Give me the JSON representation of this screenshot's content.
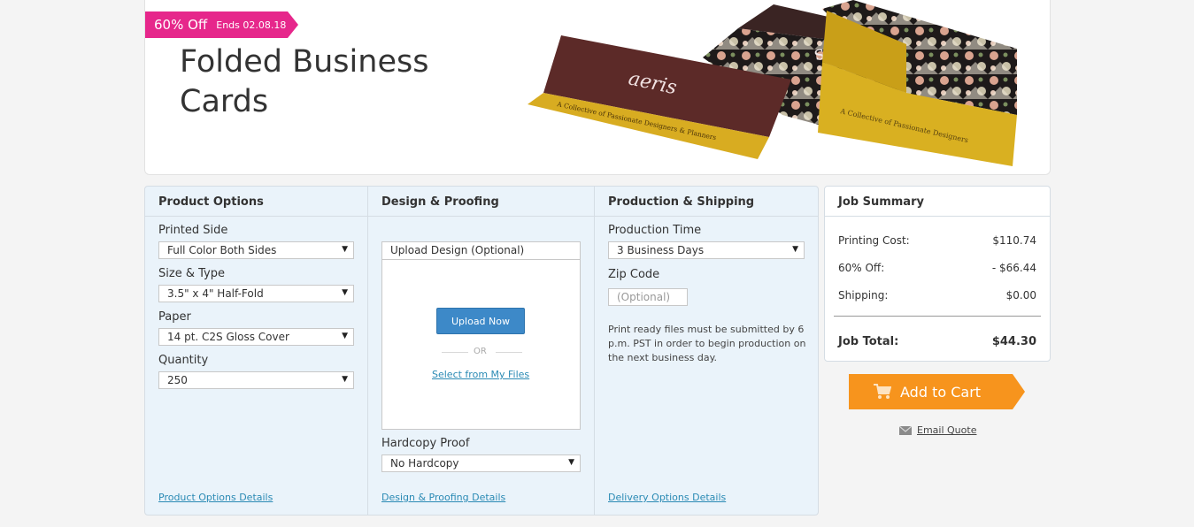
{
  "promo": {
    "discount": "60% Off",
    "ends": "Ends 02.08.18"
  },
  "hero": {
    "title": "Folded Business Cards",
    "image_brand": "aeris",
    "image_tagline": "A Collective of Passionate Designers & Planners"
  },
  "product_options": {
    "heading": "Product Options",
    "printed_side": {
      "label": "Printed Side",
      "value": "Full Color Both Sides"
    },
    "size_type": {
      "label": "Size & Type",
      "value": "3.5\" x 4\" Half-Fold"
    },
    "paper": {
      "label": "Paper",
      "value": "14 pt. C2S Gloss Cover"
    },
    "quantity": {
      "label": "Quantity",
      "value": "250"
    },
    "details_link": "Product Options Details"
  },
  "design_proofing": {
    "heading": "Design & Proofing",
    "upload_label": "Upload Design (Optional)",
    "upload_button": "Upload Now",
    "or_text": "OR",
    "select_files": "Select from My Files",
    "hardcopy": {
      "label": "Hardcopy Proof",
      "value": "No Hardcopy"
    },
    "details_link": "Design & Proofing Details"
  },
  "production_shipping": {
    "heading": "Production & Shipping",
    "production_time": {
      "label": "Production Time",
      "value": "3 Business Days"
    },
    "zip": {
      "label": "Zip Code",
      "placeholder": "(Optional)"
    },
    "note": "Print ready files must be submitted by 6 p.m. PST in order to begin production on the next business day.",
    "details_link": "Delivery Options Details"
  },
  "job_summary": {
    "heading": "Job Summary",
    "printing_cost": {
      "label": "Printing Cost:",
      "value": "$110.74"
    },
    "discount": {
      "label": "60% Off:",
      "value": "- $66.44"
    },
    "shipping": {
      "label": "Shipping:",
      "value": "$0.00"
    },
    "total": {
      "label": "Job Total:",
      "value": "$44.30"
    }
  },
  "actions": {
    "add_to_cart": "Add to Cart",
    "email_quote": "Email Quote"
  },
  "colors": {
    "promo": "#e6278b",
    "cart": "#f7941d",
    "link": "#2a8ab4",
    "button": "#3d89c8",
    "panel": "#eaf3fa"
  }
}
